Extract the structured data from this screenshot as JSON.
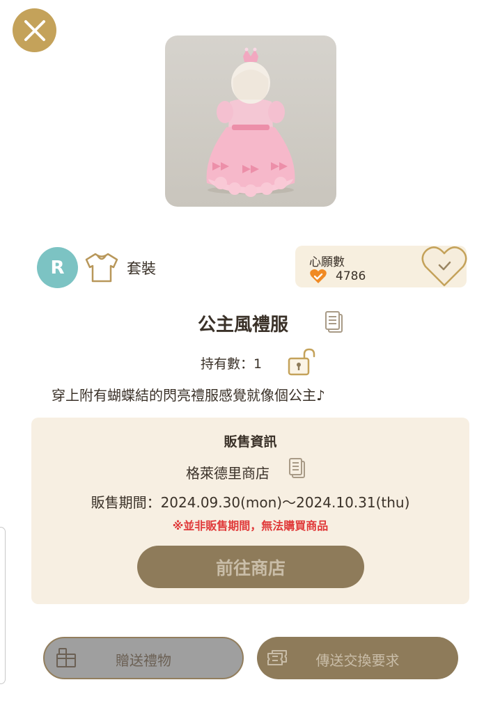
{
  "header": {
    "close_icon": "close-icon"
  },
  "item": {
    "image_icon": "princess-dress-figure",
    "rarity": "R",
    "type_icon": "shirt-icon",
    "type_label": "套裝",
    "name": "公主風禮服",
    "owned_label": "持有數：1",
    "lock_icon": "unlocked-padlock-icon",
    "description": "穿上附有蝴蝶結的閃亮禮服感覺就像個公主♪"
  },
  "wishlist": {
    "title": "心願數",
    "count": "4786",
    "heart_icon": "heart-check-icon"
  },
  "sale_info": {
    "title": "販售資訊",
    "shop": "格萊德里商店",
    "period": "販售期間：2024.09.30(mon)～2024.10.31(thu)",
    "warning": "※並非販售期間，無法購買商品",
    "goto_button": "前往商店"
  },
  "actions": {
    "gift_label": "贈送禮物",
    "trade_label": "傳送交換要求"
  },
  "colors": {
    "accent_gold": "#c4a25a",
    "button_brown": "#8e7b5a",
    "panel_cream": "#f7efe2",
    "warning_red": "#e03a3a",
    "rarity_teal": "#7cc3c3",
    "heart_orange": "#f08a24"
  }
}
